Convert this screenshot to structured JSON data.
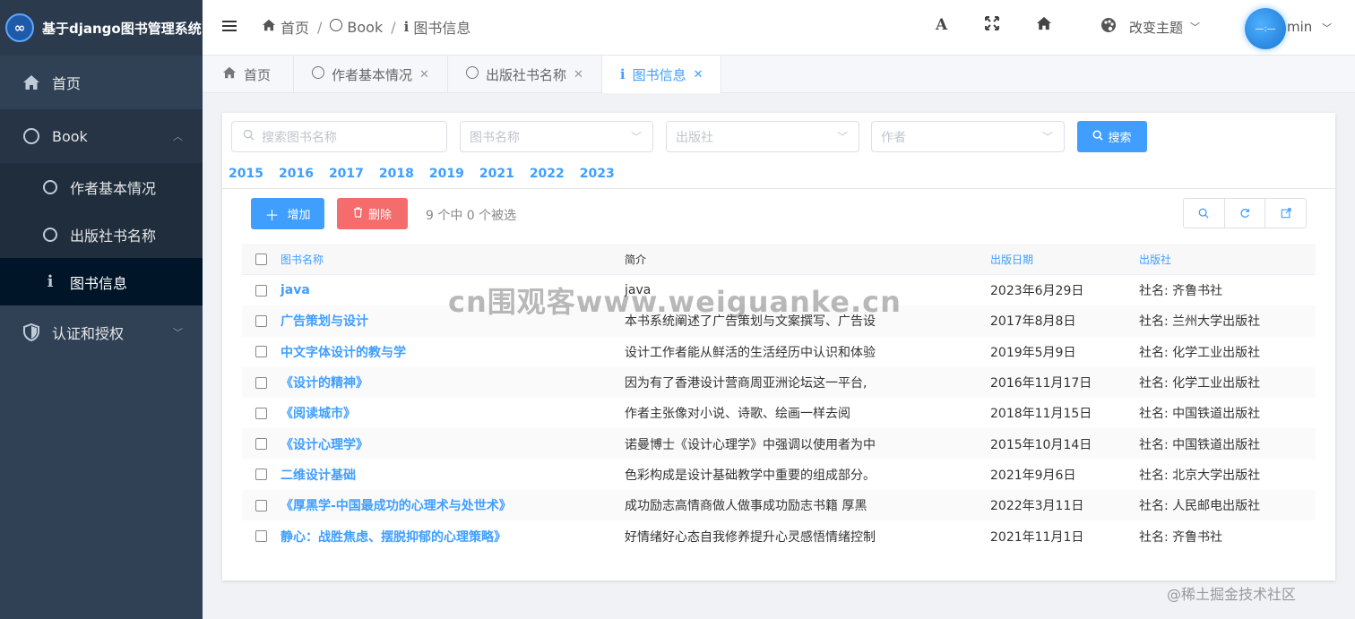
{
  "brand": {
    "logo": "∞",
    "title": "基于django图书管理系统"
  },
  "sidebar": {
    "items": [
      {
        "label": "首页",
        "icon": "home-icon"
      },
      {
        "label": "Book",
        "icon": "circle-icon",
        "expanded": true,
        "children": [
          {
            "label": "作者基本情况",
            "icon": "circle-icon"
          },
          {
            "label": "出版社书名称",
            "icon": "circle-icon"
          },
          {
            "label": "图书信息",
            "icon": "info-icon",
            "active": true
          }
        ]
      },
      {
        "label": "认证和授权",
        "icon": "shield-icon"
      }
    ]
  },
  "header": {
    "breadcrumb": [
      {
        "label": "首页",
        "icon": "home-icon"
      },
      {
        "label": "Book",
        "icon": "circle-icon"
      },
      {
        "label": "图书信息",
        "icon": "info-icon"
      }
    ],
    "font_icon": "A",
    "theme_label": "改变主题",
    "avatar_text": "—:—",
    "user": "min"
  },
  "tabs": [
    {
      "label": "首页",
      "icon": "home-icon",
      "closable": false
    },
    {
      "label": "作者基本情况",
      "icon": "circle-icon",
      "closable": true
    },
    {
      "label": "出版社书名称",
      "icon": "circle-icon",
      "closable": true
    },
    {
      "label": "图书信息",
      "icon": "info-icon",
      "closable": true,
      "active": true
    }
  ],
  "filters": {
    "search_placeholder": "搜索图书名称",
    "name_placeholder": "图书名称",
    "publisher_placeholder": "出版社",
    "author_placeholder": "作者",
    "search_button": "搜索"
  },
  "years": [
    "2015",
    "2016",
    "2017",
    "2018",
    "2019",
    "2021",
    "2022",
    "2023"
  ],
  "actions": {
    "add": "增加",
    "delete": "删除",
    "selection_info": "9 个中 0 个被选"
  },
  "table": {
    "headers": {
      "name": "图书名称",
      "intro": "简介",
      "date": "出版日期",
      "publisher": "出版社"
    },
    "rows": [
      {
        "name": "java",
        "intro": "java",
        "date": "2023年6月29日",
        "publisher": "社名: 齐鲁书社"
      },
      {
        "name": "广告策划与设计",
        "intro": "本书系统阐述了广告策划与文案撰写、广告设",
        "date": "2017年8月8日",
        "publisher": "社名: 兰州大学出版社"
      },
      {
        "name": "中文字体设计的教与学",
        "intro": "设计工作者能从鲜活的生活经历中认识和体验",
        "date": "2019年5月9日",
        "publisher": "社名: 化学工业出版社"
      },
      {
        "name": "《设计的精神》",
        "intro": "因为有了香港设计营商周亚洲论坛这一平台,",
        "date": "2016年11月17日",
        "publisher": "社名: 化学工业出版社"
      },
      {
        "name": "《阅读城市》",
        "intro": "作者主张像对小说、诗歌、绘画一样去阅",
        "date": "2018年11月15日",
        "publisher": "社名: 中国铁道出版社"
      },
      {
        "name": "《设计心理学》",
        "intro": "诺曼博士《设计心理学》中强调以使用者为中",
        "date": "2015年10月14日",
        "publisher": "社名: 中国铁道出版社"
      },
      {
        "name": "二维设计基础",
        "intro": "色彩构成是设计基础教学中重要的组成部分。",
        "date": "2021年9月6日",
        "publisher": "社名: 北京大学出版社"
      },
      {
        "name": "《厚黑学-中国最成功的心理术与处世术》",
        "intro": "成功励志高情商做人做事成功励志书籍 厚黑",
        "date": "2022年3月11日",
        "publisher": "社名: 人民邮电出版社"
      },
      {
        "name": "静心：战胜焦虑、摆脱抑郁的心理策略》",
        "intro": "好情绪好心态自我修养提升心灵感悟情绪控制",
        "date": "2021年11月1日",
        "publisher": "社名: 齐鲁书社"
      }
    ]
  },
  "watermark": "cn围观客www.weiguanke.cn",
  "footer_credit": "@稀土掘金技术社区",
  "colors": {
    "primary": "#409eff",
    "danger": "#f56c6c",
    "sidebar": "#304156"
  }
}
